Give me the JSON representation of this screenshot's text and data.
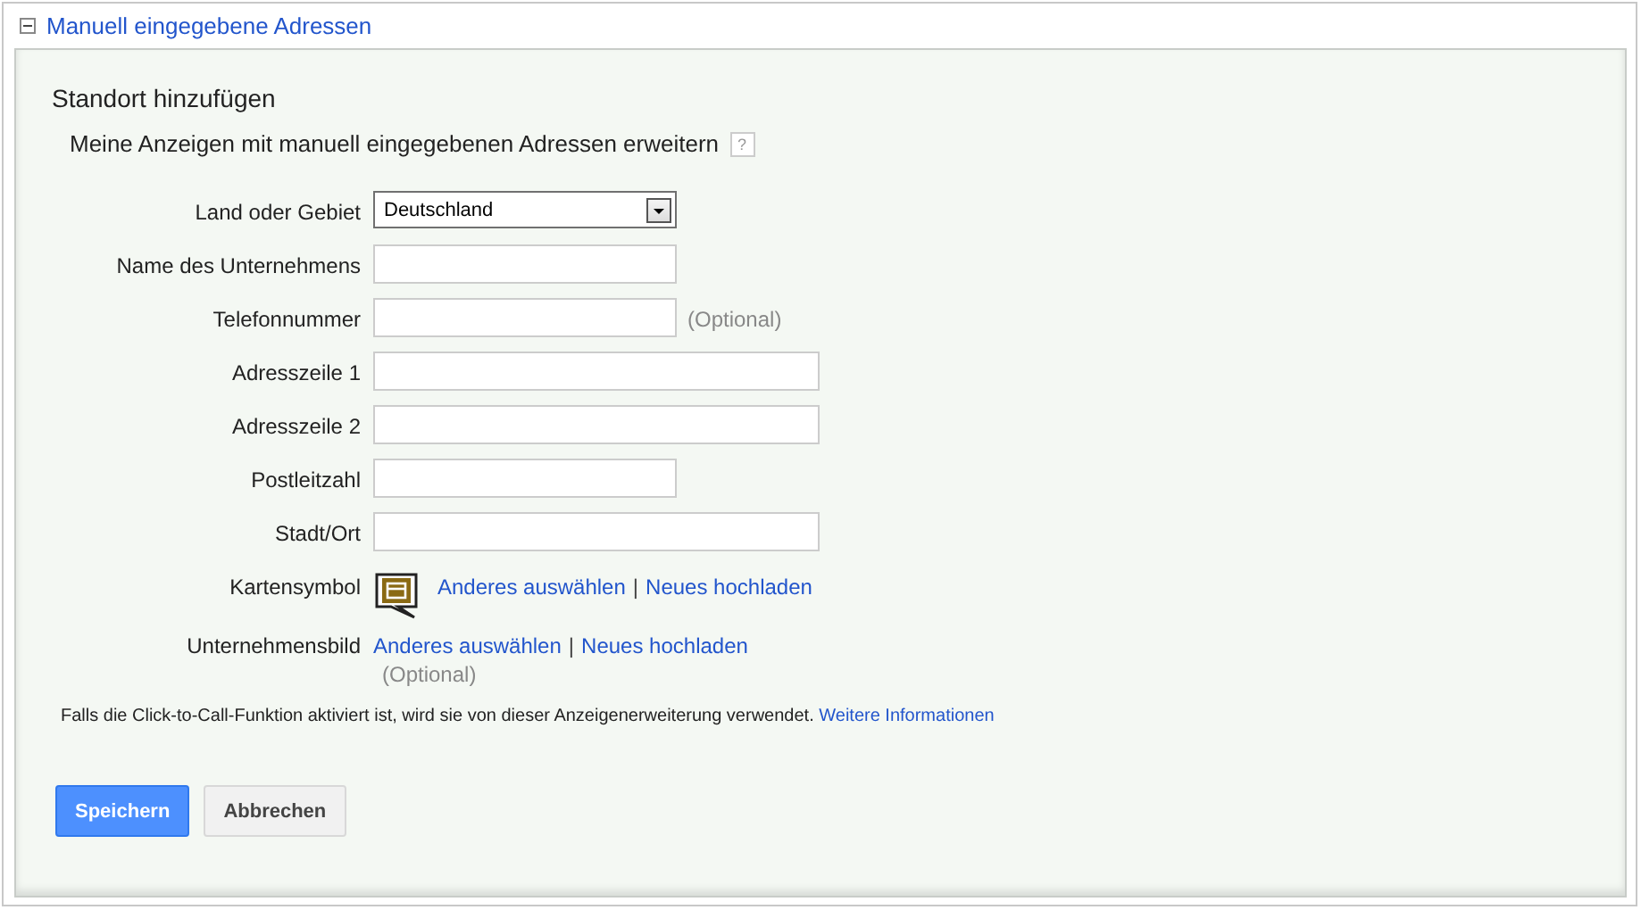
{
  "section": {
    "title": "Manuell eingegebene Adressen",
    "expanded": true
  },
  "form": {
    "heading": "Standort hinzufügen",
    "subtitle": "Meine Anzeigen mit manuell eingegebenen Adressen erweitern",
    "help": "?"
  },
  "fields": [
    {
      "kind": "select",
      "label": "Land oder Gebiet",
      "value": "Deutschland"
    },
    {
      "kind": "short-text",
      "label": "Name des Unternehmens"
    },
    {
      "kind": "short-text",
      "label": "Telefonnummer",
      "note": "(Optional)"
    },
    {
      "kind": "long-text",
      "label": "Adresszeile 1"
    },
    {
      "kind": "long-text",
      "label": "Adresszeile 2"
    },
    {
      "kind": "short-text",
      "label": "Postleitzahl"
    },
    {
      "kind": "long-text",
      "label": "Stadt/Ort"
    },
    {
      "kind": "icon-links",
      "label": "Kartensymbol",
      "links": [
        "Anderes auswählen",
        "Neues hochladen"
      ],
      "separator": "|"
    },
    {
      "kind": "links",
      "label": "Unternehmensbild",
      "links": [
        "Anderes auswählen",
        "Neues hochladen"
      ],
      "separator": "|",
      "note": "(Optional)"
    }
  ],
  "footnote": {
    "text": "Falls die Click-to-Call-Funktion aktiviert ist, wird sie von dieser Anzeigenerweiterung verwendet.",
    "link": "Weitere Informationen"
  },
  "buttons": [
    {
      "kind": "primary",
      "label": "Speichern"
    },
    {
      "kind": "secondary",
      "label": "Abbrechen"
    }
  ]
}
